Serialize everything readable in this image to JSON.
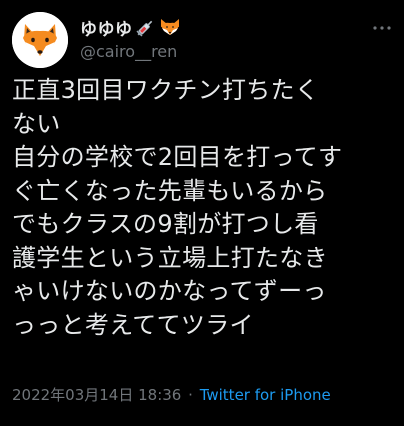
{
  "author": {
    "display_name": "ゆゆゆ",
    "handle": "@cairo__ren",
    "name_emojis": [
      "syringe-icon",
      "fox-face-icon"
    ]
  },
  "tweet": {
    "text": "正直3回目ワクチン打ちたく\nない\n自分の学校で2回目を打ってす\nぐ亡くなった先輩もいるから\nでもクラスの9割が打つし看\n護学生という立場上打たなき\nゃいけないのかなってずーっ\nっっと考えててツライ",
    "date": "2022年03月14日 18:36",
    "separator": "·",
    "source": "Twitter for iPhone"
  },
  "colors": {
    "background": "#000000",
    "text_primary": "#e7e9ea",
    "text_secondary": "#71767b",
    "link": "#1d9bf0"
  }
}
